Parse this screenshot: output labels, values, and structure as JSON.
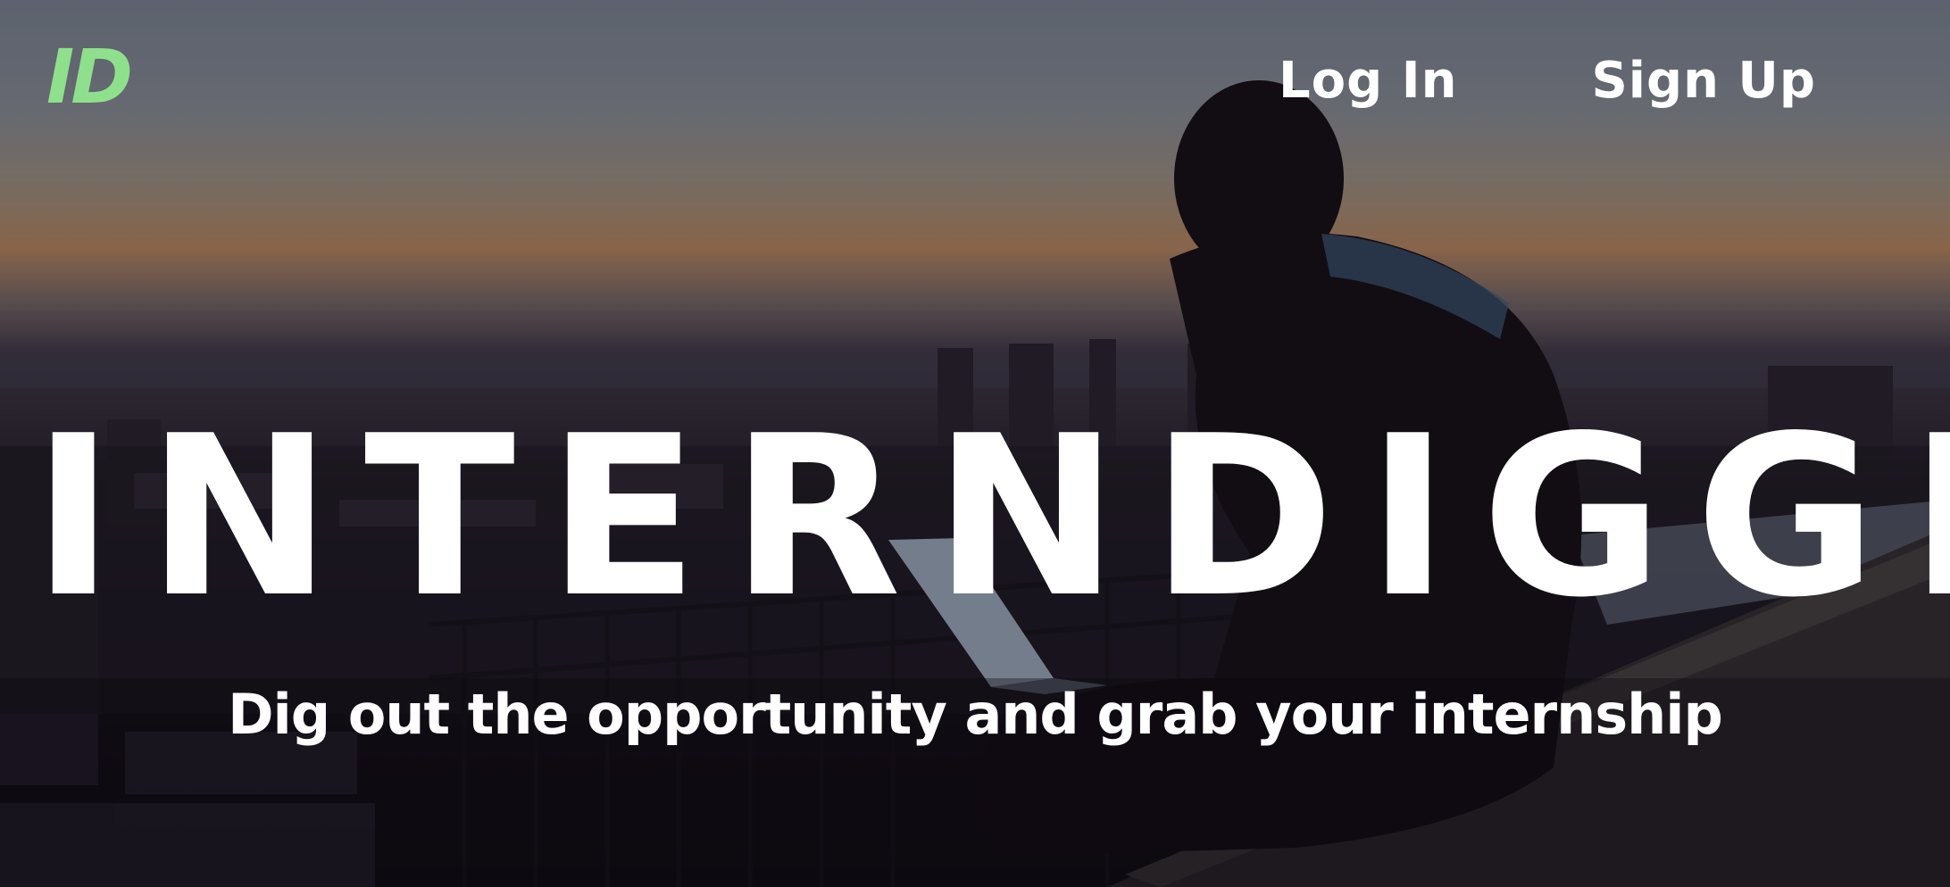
{
  "header": {
    "logo_text": "ID",
    "logo_color": "#8fe08c",
    "nav": {
      "login_label": "Log In",
      "signup_label": "Sign Up"
    }
  },
  "hero": {
    "title": "INTERNDIGGER",
    "tagline": "Dig out the opportunity and grab your internship",
    "background_image": "person-with-laptop-city-sunset"
  },
  "colors": {
    "accent": "#8fe08c",
    "text": "#ffffff"
  }
}
